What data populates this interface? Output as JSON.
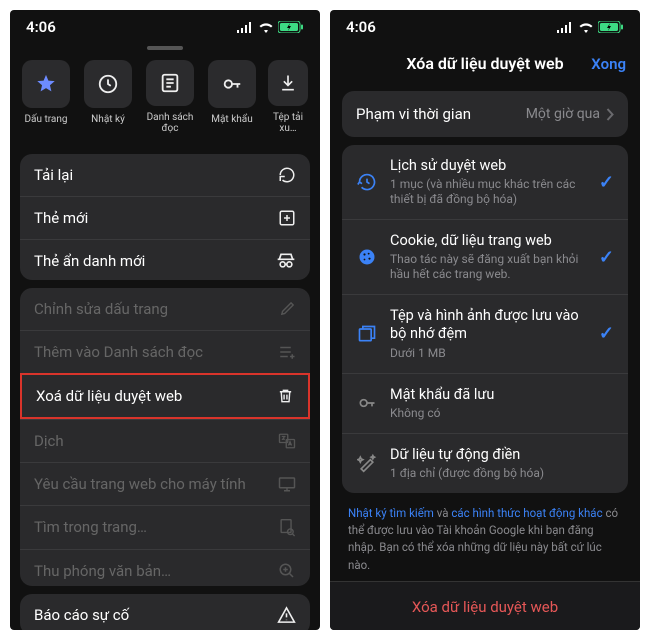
{
  "status": {
    "time": "4:06",
    "signal": "•ıll",
    "wifi": "wifi",
    "battery": "battery-charging"
  },
  "left": {
    "quick": [
      {
        "label": "Dấu trang",
        "icon": "star"
      },
      {
        "label": "Nhật ký",
        "icon": "clock"
      },
      {
        "label": "Danh sách đọc",
        "icon": "reading-list"
      },
      {
        "label": "Mật khẩu",
        "icon": "key"
      },
      {
        "label": "Tệp tải xu…",
        "icon": "download"
      }
    ],
    "group1": [
      {
        "label": "Tải lại",
        "icon": "reload"
      },
      {
        "label": "Thẻ mới",
        "icon": "plus-box"
      },
      {
        "label": "Thẻ ẩn danh mới",
        "icon": "incognito"
      }
    ],
    "group2": [
      {
        "label": "Chỉnh sửa dấu trang",
        "icon": "pencil",
        "dim": true
      },
      {
        "label": "Thêm vào Danh sách đọc",
        "icon": "list-add",
        "dim": true
      },
      {
        "label": "Xoá dữ liệu duyệt web",
        "icon": "trash",
        "dim": false,
        "highlight": true
      },
      {
        "label": "Dịch",
        "icon": "translate",
        "dim": true
      },
      {
        "label": "Yêu cầu trang web cho máy tính",
        "icon": "monitor",
        "dim": true
      },
      {
        "label": "Tìm trong trang…",
        "icon": "find",
        "dim": true
      },
      {
        "label": "Thu phóng văn bản…",
        "icon": "zoom-text",
        "dim": true
      }
    ],
    "group3": [
      {
        "label": "Báo cáo sự cố",
        "icon": "warning"
      }
    ]
  },
  "right": {
    "title": "Xóa dữ liệu duyệt web",
    "done": "Xong",
    "time_range": {
      "label": "Phạm vi thời gian",
      "value": "Một giờ qua"
    },
    "items": [
      {
        "title": "Lịch sử duyệt web",
        "sub": "1 mục (và nhiều mục khác trên các thiết bị đã đồng bộ hóa)",
        "icon": "history",
        "checked": true
      },
      {
        "title": "Cookie, dữ liệu trang web",
        "sub": "Thao tác này sẽ đăng xuất bạn khỏi hầu hết các trang web.",
        "icon": "cookie",
        "checked": true
      },
      {
        "title": "Tệp và hình ảnh được lưu vào bộ nhớ đệm",
        "sub": "Dưới 1 MB",
        "icon": "cache",
        "checked": true
      },
      {
        "title": "Mật khẩu đã lưu",
        "sub": "Không có",
        "icon": "key-dim",
        "checked": false
      },
      {
        "title": "Dữ liệu tự động điền",
        "sub": "1 địa chỉ (được đồng bộ hóa)",
        "icon": "wand",
        "checked": false
      }
    ],
    "footnote": {
      "a": "Nhật ký tìm kiếm",
      "b": " và ",
      "c": "các hình thức hoạt động khác",
      "d": " có thể được lưu vào Tài khoản Google khi bạn đăng nhập. Bạn có thể xóa những dữ liệu này bất cứ lúc nào."
    },
    "action": "Xóa dữ liệu duyệt web"
  }
}
